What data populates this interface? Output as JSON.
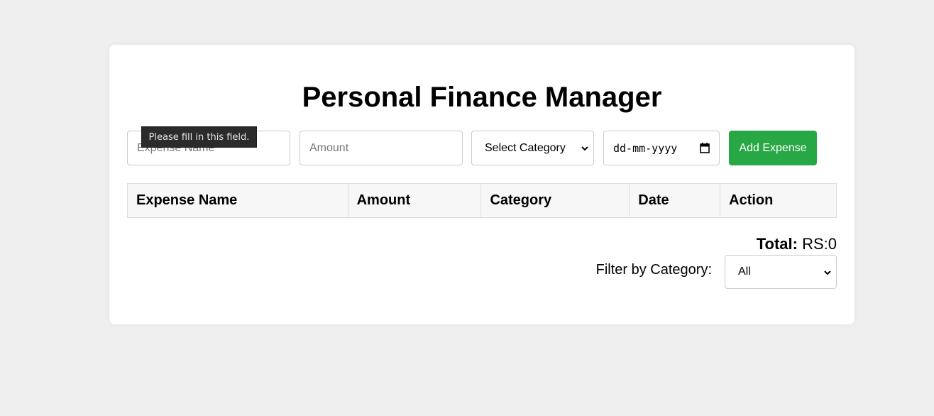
{
  "header": {
    "title": "Personal Finance Manager"
  },
  "form": {
    "expense_name_placeholder": "Expense Name",
    "amount_placeholder": "Amount",
    "category_selected": "Select Category",
    "date_placeholder": "dd-mm-yyyy",
    "add_button_label": "Add Expense",
    "tooltip": "Please fill in this field."
  },
  "table": {
    "columns": [
      "Expense Name",
      "Amount",
      "Category",
      "Date",
      "Action"
    ],
    "rows": []
  },
  "summary": {
    "total_label": "Total:",
    "total_value": "RS:0"
  },
  "filter": {
    "label": "Filter by Category:",
    "selected": "All"
  },
  "colors": {
    "accent_green": "#28a745",
    "background": "#efefef"
  },
  "icons": {
    "category_dropdown": "chevron-down-icon",
    "date_picker": "calendar-icon",
    "filter_dropdown": "chevron-down-icon"
  }
}
